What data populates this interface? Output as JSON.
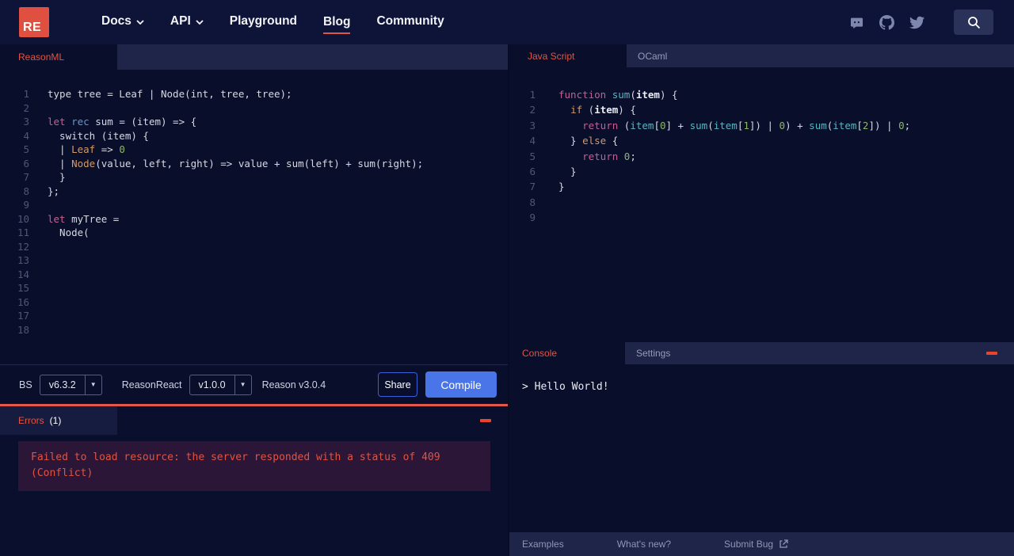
{
  "colors": {
    "accent_red": "#e25444",
    "accent_blue": "#4a75e8",
    "logo_bg": "#df5040",
    "error_text": "#e05442"
  },
  "navbar": {
    "logo_text": "RE",
    "items": [
      {
        "label": "Docs",
        "caret": true,
        "active": false
      },
      {
        "label": "API",
        "caret": true,
        "active": false
      },
      {
        "label": "Playground",
        "caret": false,
        "active": false
      },
      {
        "label": "Blog",
        "caret": false,
        "active": true
      },
      {
        "label": "Community",
        "caret": false,
        "active": false
      }
    ],
    "social_icons": [
      "discord-icon",
      "github-icon",
      "twitter-icon"
    ],
    "search_icon": "search-icon"
  },
  "reason_editor": {
    "tab_label": "ReasonML",
    "total_lines": 18,
    "lines": [
      {
        "n": 1,
        "tokens": [
          [
            "d",
            "type tree = Leaf | Node(int, tree, tree);"
          ]
        ]
      },
      {
        "n": 3,
        "tokens": [
          [
            "k",
            "let"
          ],
          [
            "d",
            " "
          ],
          [
            "b",
            "rec"
          ],
          [
            "d",
            " sum = (item) => {"
          ]
        ]
      },
      {
        "n": 4,
        "tokens": [
          [
            "d",
            "  switch (item) {"
          ]
        ]
      },
      {
        "n": 5,
        "tokens": [
          [
            "d",
            "  | "
          ],
          [
            "o",
            "Leaf"
          ],
          [
            "d",
            " => "
          ],
          [
            "g",
            "0"
          ]
        ]
      },
      {
        "n": 6,
        "tokens": [
          [
            "d",
            "  | "
          ],
          [
            "o",
            "Node"
          ],
          [
            "d",
            "(value, left, right) => value + sum(left) + sum(right);"
          ]
        ]
      },
      {
        "n": 7,
        "tokens": [
          [
            "d",
            "  }"
          ]
        ]
      },
      {
        "n": 8,
        "tokens": [
          [
            "d",
            "};"
          ]
        ]
      },
      {
        "n": 10,
        "tokens": [
          [
            "k",
            "let"
          ],
          [
            "d",
            " myTree ="
          ]
        ]
      },
      {
        "n": 11,
        "tokens": [
          [
            "d",
            "  Node("
          ]
        ]
      }
    ]
  },
  "js_editor": {
    "tabs": [
      {
        "label": "Java Script",
        "active": true
      },
      {
        "label": "OCaml",
        "active": false
      }
    ],
    "total_lines": 9,
    "lines": [
      {
        "n": 1,
        "tokens": [
          [
            "k",
            "function"
          ],
          [
            "d",
            " "
          ],
          [
            "t",
            "sum"
          ],
          [
            "d",
            "("
          ],
          [
            "w",
            "item"
          ],
          [
            "d",
            ") {"
          ]
        ]
      },
      {
        "n": 2,
        "tokens": [
          [
            "d",
            "  "
          ],
          [
            "o",
            "if"
          ],
          [
            "d",
            " ("
          ],
          [
            "w",
            "item"
          ],
          [
            "d",
            ") {"
          ]
        ]
      },
      {
        "n": 3,
        "tokens": [
          [
            "d",
            "    "
          ],
          [
            "k",
            "return"
          ],
          [
            "d",
            " ("
          ],
          [
            "t",
            "item"
          ],
          [
            "d",
            "["
          ],
          [
            "g",
            "0"
          ],
          [
            "d",
            "] + "
          ],
          [
            "t",
            "sum"
          ],
          [
            "d",
            "("
          ],
          [
            "t",
            "item"
          ],
          [
            "d",
            "["
          ],
          [
            "g",
            "1"
          ],
          [
            "d",
            "]) | "
          ],
          [
            "g",
            "0"
          ],
          [
            "d",
            ") + "
          ],
          [
            "t",
            "sum"
          ],
          [
            "d",
            "("
          ],
          [
            "t",
            "item"
          ],
          [
            "d",
            "["
          ],
          [
            "g",
            "2"
          ],
          [
            "d",
            "]) | "
          ],
          [
            "g",
            "0"
          ],
          [
            "d",
            ";"
          ]
        ]
      },
      {
        "n": 4,
        "tokens": [
          [
            "d",
            "  } "
          ],
          [
            "o",
            "else"
          ],
          [
            "d",
            " {"
          ]
        ]
      },
      {
        "n": 5,
        "tokens": [
          [
            "d",
            "    "
          ],
          [
            "k",
            "return"
          ],
          [
            "d",
            " "
          ],
          [
            "g",
            "0"
          ],
          [
            "d",
            ";"
          ]
        ]
      },
      {
        "n": 6,
        "tokens": [
          [
            "d",
            "  }"
          ]
        ]
      },
      {
        "n": 7,
        "tokens": [
          [
            "d",
            "}"
          ]
        ]
      }
    ]
  },
  "toolbar": {
    "bs_label": "BS",
    "bs_version": "v6.3.2",
    "reasonreact_label": "ReasonReact",
    "reasonreact_version": "v1.0.0",
    "reason_version": "Reason v3.0.4",
    "share_label": "Share",
    "compile_label": "Compile"
  },
  "errors_panel": {
    "title": "Errors",
    "count": "(1)",
    "message_lines": [
      "Failed to load resource: the server responded with a status of 409",
      "(Conflict)"
    ]
  },
  "console_panel": {
    "tabs": [
      {
        "label": "Console",
        "active": true
      },
      {
        "label": "Settings",
        "active": false
      }
    ],
    "output": "> Hello World!"
  },
  "footer": {
    "items": [
      {
        "label": "Examples",
        "external_icon": false
      },
      {
        "label": "What's new?",
        "external_icon": false
      },
      {
        "label": "Submit Bug",
        "external_icon": true
      }
    ]
  }
}
